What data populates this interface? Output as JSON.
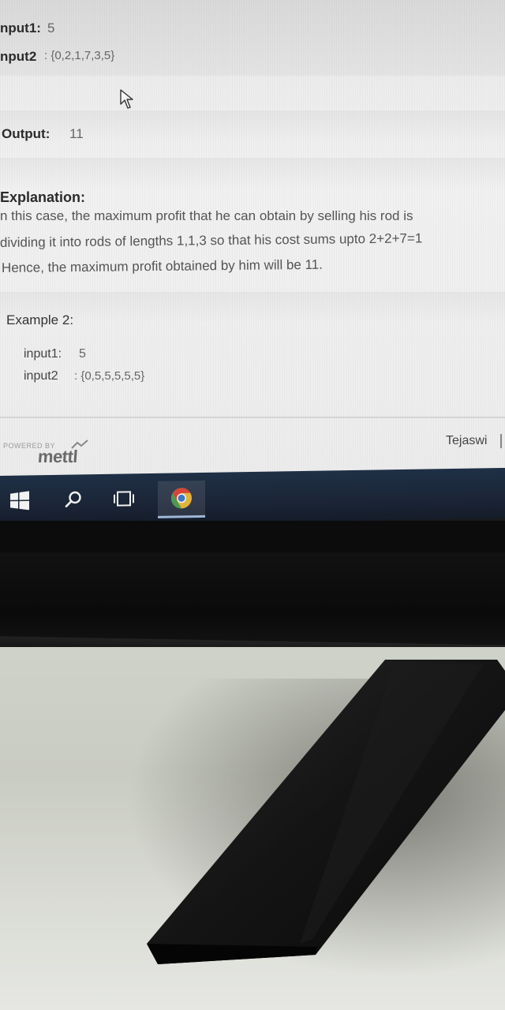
{
  "problem": {
    "example1": {
      "input1_label": "nput1:",
      "input1_value": "5",
      "input2_label": "nput2",
      "input2_value": ": {0,2,1,7,3,5}"
    },
    "output_label": "Output:",
    "output_value": "11",
    "explanation_label": "Explanation:",
    "explanation_lines": [
      "n this case, the maximum profit that he can obtain by selling his rod is",
      "dividing it into rods of lengths 1,1,3 so that his cost sums upto 2+2+7=1",
      "Hence, the maximum profit obtained by him will be 11."
    ],
    "example2": {
      "heading": "Example 2:",
      "input1_label": "input1:",
      "input1_value": "5",
      "input2_label": "input2",
      "input2_value": ": {0,5,5,5,5,5}"
    }
  },
  "footer": {
    "powered_by": "POWERED BY",
    "brand": "mettl",
    "user_name": "Tejaswi"
  },
  "taskbar": {
    "items": [
      "windows-start",
      "search",
      "task-view",
      "chrome"
    ]
  },
  "colors": {
    "taskbar": "#1b2537",
    "screen_bg": "#efefef",
    "bezel": "#0c0c0c"
  }
}
